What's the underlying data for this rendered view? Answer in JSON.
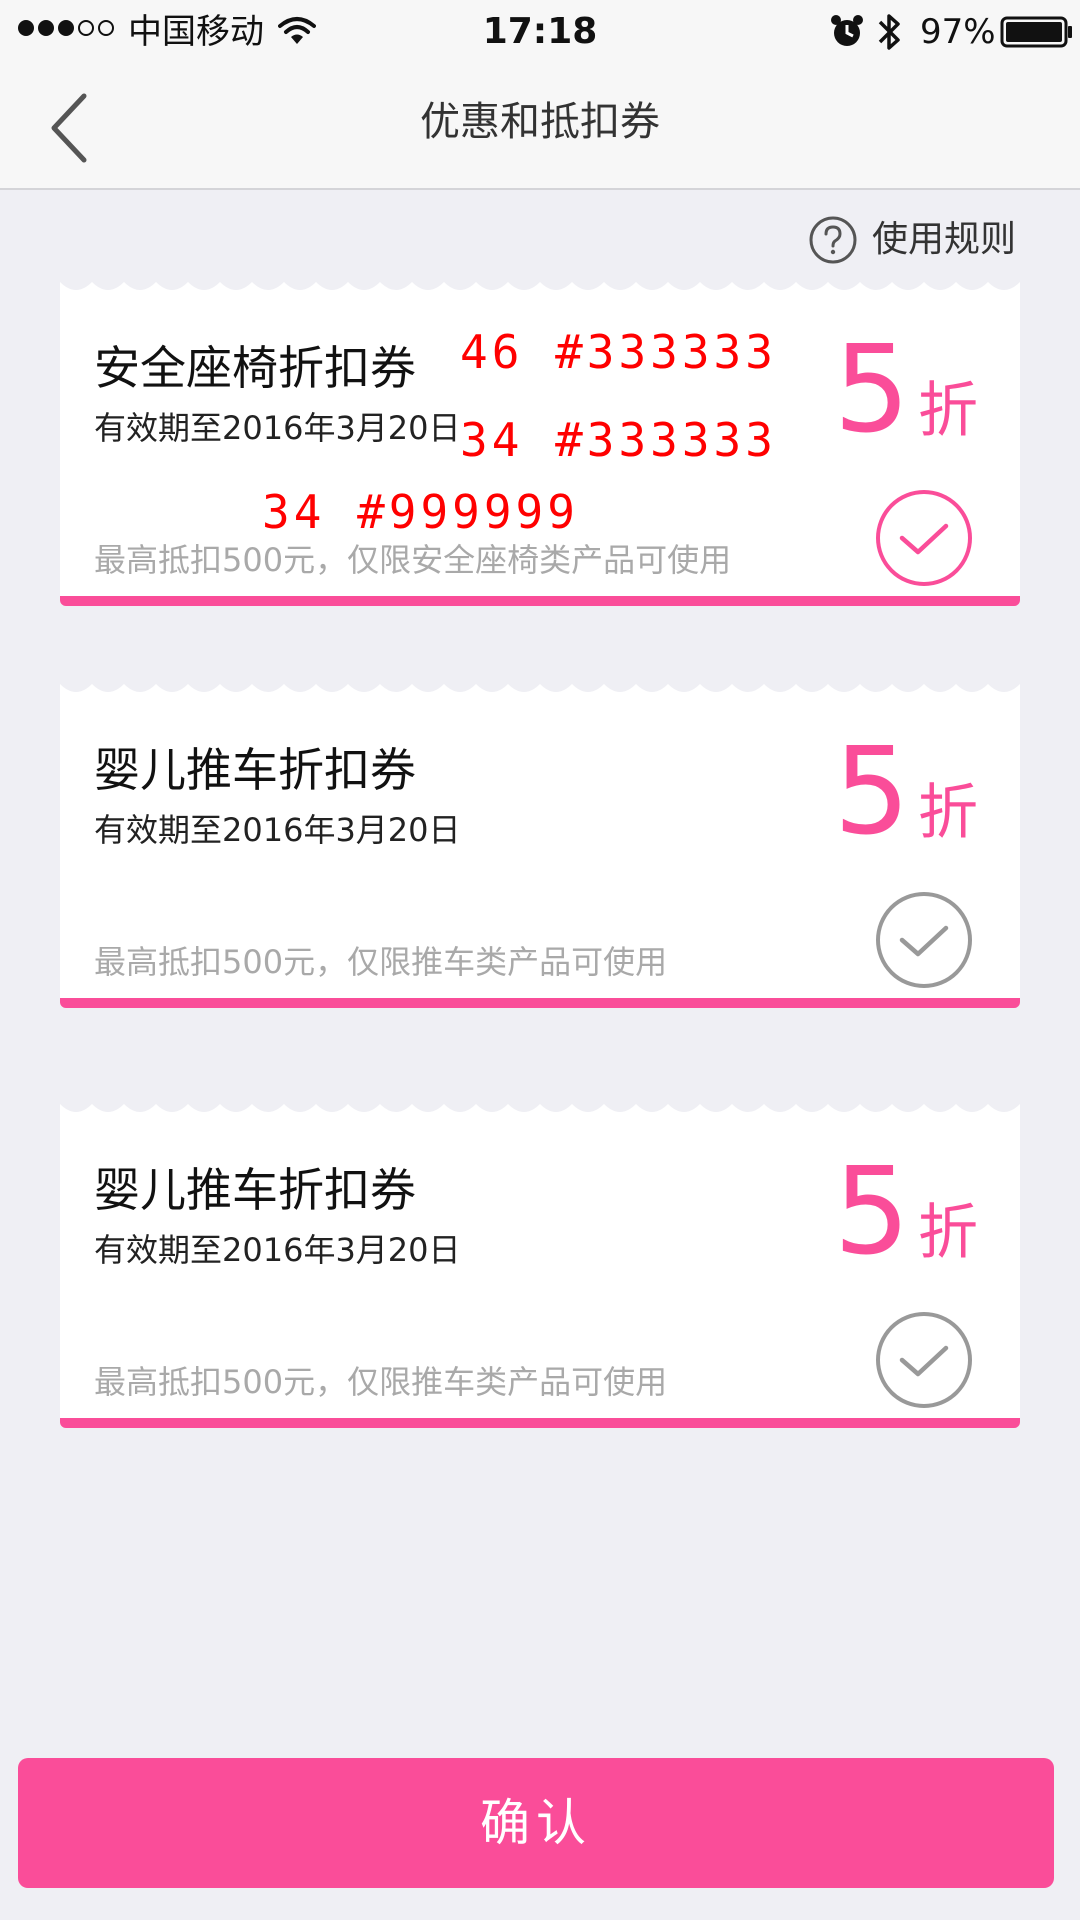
{
  "status_bar": {
    "carrier": "中国移动",
    "time": "17:18",
    "battery": "97%"
  },
  "nav": {
    "title": "优惠和抵扣券"
  },
  "rules": {
    "label": "使用规则"
  },
  "coupons": [
    {
      "title": "安全座椅折扣券",
      "validity": "有效期至2016年3月20日",
      "discount_value": "5",
      "discount_unit": "折",
      "description": "最高抵扣500元，仅限安全座椅类产品可使用",
      "selected": true
    },
    {
      "title": "婴儿推车折扣券",
      "validity": "有效期至2016年3月20日",
      "discount_value": "5",
      "discount_unit": "折",
      "description": "最高抵扣500元，仅限推车类产品可使用",
      "selected": false
    },
    {
      "title": "婴儿推车折扣券",
      "validity": "有效期至2016年3月20日",
      "discount_value": "5",
      "discount_unit": "折",
      "description": "最高抵扣500元，仅限推车类产品可使用",
      "selected": false
    }
  ],
  "annotations": [
    "46 #333333",
    "34 #333333",
    "34 #999999"
  ],
  "confirm": {
    "label": "确认"
  },
  "colors": {
    "accent": "#fa4d99",
    "background": "#efeff4",
    "unselected": "#999999",
    "annotation": "#ff0000"
  }
}
